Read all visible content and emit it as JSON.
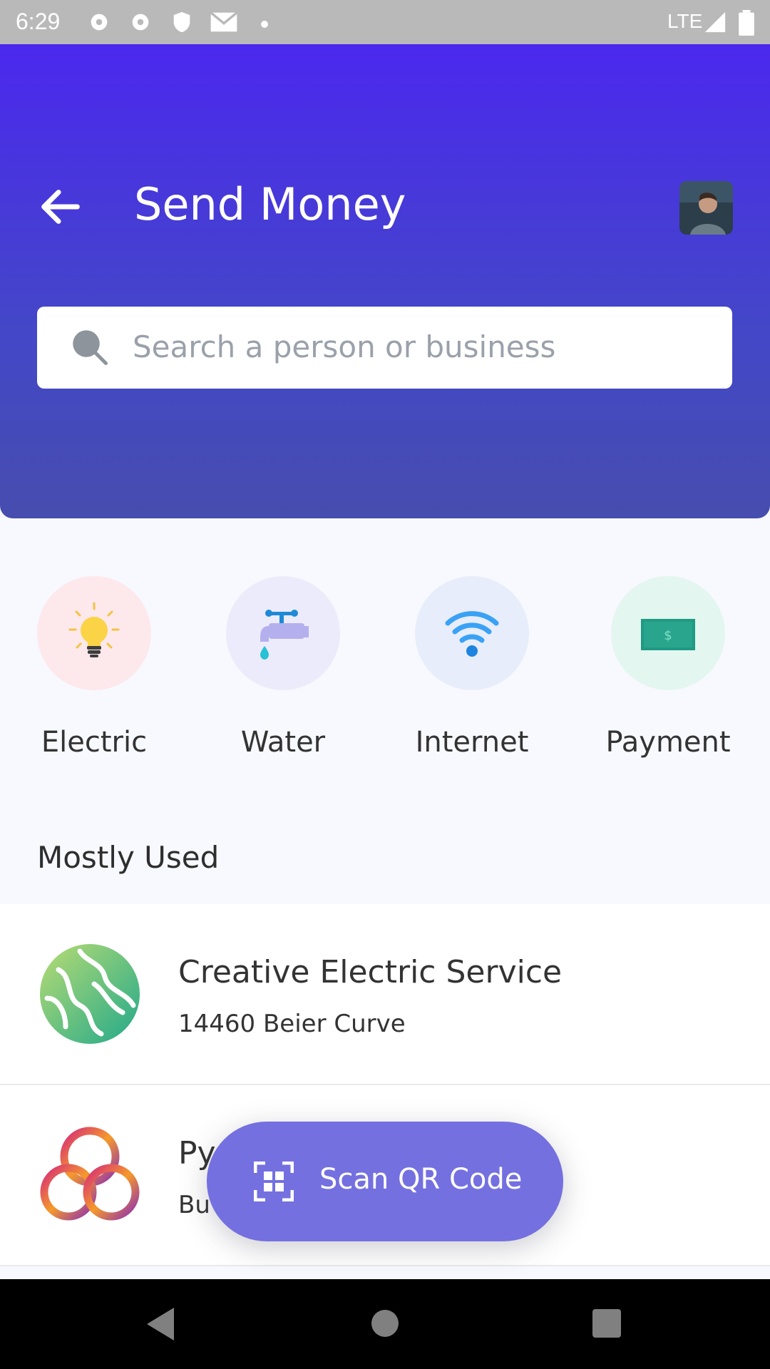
{
  "status": {
    "time": "6:29",
    "network": "LTE"
  },
  "header": {
    "title": "Send Money"
  },
  "search": {
    "placeholder": "Search a person or business"
  },
  "categories": [
    {
      "label": "Electric",
      "icon": "lightbulb-icon",
      "bg": "#fde8ec"
    },
    {
      "label": "Water",
      "icon": "water-tap-icon",
      "bg": "#ecebfb"
    },
    {
      "label": "Internet",
      "icon": "wifi-icon",
      "bg": "#e8edfb"
    },
    {
      "label": "Payment",
      "icon": "money-bill-icon",
      "bg": "#e3f6ef"
    }
  ],
  "section": {
    "title": "Mostly Used"
  },
  "mostly_used": [
    {
      "name": "Creative Electric Service",
      "address": "14460 Beier Curve",
      "logo": "globe-logo"
    },
    {
      "name": "Py",
      "address": "Bu",
      "logo": "knot-logo"
    }
  ],
  "fab": {
    "label": "Scan QR Code",
    "icon": "qr-scan-icon"
  },
  "colors": {
    "primary": "#4b28ee",
    "fab": "#7470e0"
  }
}
